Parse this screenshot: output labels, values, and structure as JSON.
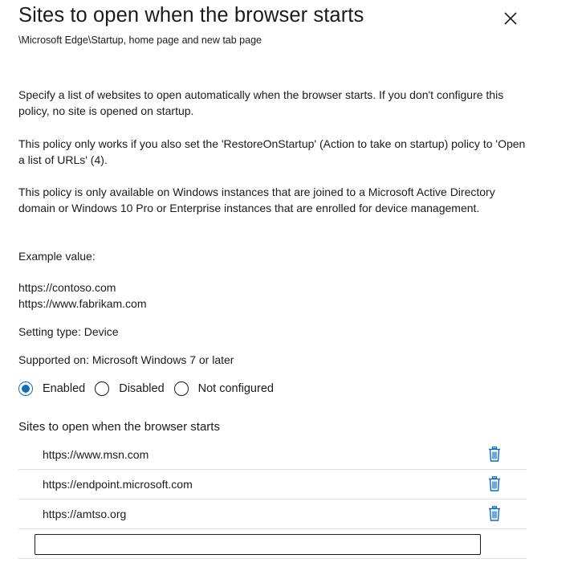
{
  "header": {
    "title": "Sites to open when the browser starts",
    "breadcrumb": "\\Microsoft Edge\\Startup, home page and new tab page"
  },
  "description": {
    "p1": "Specify a list of websites to open automatically when the browser starts. If you don't configure this policy, no site is opened on startup.",
    "p2": "This policy only works if you also set the 'RestoreOnStartup' (Action to take on startup) policy to 'Open a list of URLs' (4).",
    "p3": "This policy is only available on Windows instances that are joined to a Microsoft Active Directory domain or Windows 10 Pro or Enterprise instances that are enrolled for device management.",
    "example_label": "Example value:",
    "example_values": [
      "https://contoso.com",
      "https://www.fabrikam.com"
    ],
    "setting_type": "Setting type: Device",
    "supported_on": "Supported on: Microsoft Windows 7 or later"
  },
  "state": {
    "options": [
      "Enabled",
      "Disabled",
      "Not configured"
    ],
    "selected": "Enabled"
  },
  "sites": {
    "section_title": "Sites to open when the browser starts",
    "items": [
      "https://www.msn.com",
      "https://endpoint.microsoft.com",
      "https://amtso.org"
    ],
    "new_value": ""
  },
  "colors": {
    "accent": "#0f6cbd",
    "text": "#1b1b1b",
    "divider": "#e1e1e1"
  },
  "icons": {
    "close": "close-icon",
    "delete": "trash-icon"
  }
}
